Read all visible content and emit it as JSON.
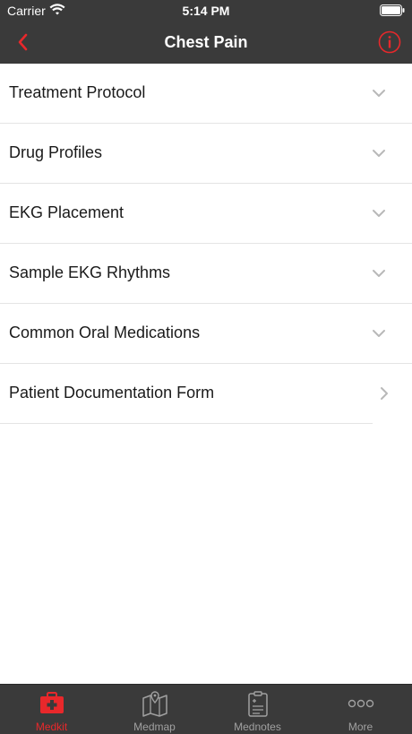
{
  "status_bar": {
    "carrier": "Carrier",
    "time": "5:14 PM"
  },
  "nav": {
    "title": "Chest Pain",
    "back_icon": "chevron-left-icon",
    "info_icon": "info-circle-icon"
  },
  "list": {
    "items": [
      {
        "label": "Treatment Protocol",
        "icon": "chevron-down-icon"
      },
      {
        "label": "Drug Profiles",
        "icon": "chevron-down-icon"
      },
      {
        "label": "EKG Placement",
        "icon": "chevron-down-icon"
      },
      {
        "label": "Sample EKG Rhythms",
        "icon": "chevron-down-icon"
      },
      {
        "label": "Common Oral Medications",
        "icon": "chevron-down-icon"
      },
      {
        "label": "Patient Documentation Form",
        "icon": "chevron-right-icon"
      }
    ]
  },
  "tabbar": {
    "tabs": [
      {
        "label": "Medkit",
        "icon": "medkit-icon",
        "active": true
      },
      {
        "label": "Medmap",
        "icon": "map-icon",
        "active": false
      },
      {
        "label": "Mednotes",
        "icon": "clipboard-icon",
        "active": false
      },
      {
        "label": "More",
        "icon": "more-dots-icon",
        "active": false
      }
    ]
  },
  "colors": {
    "accent": "#e8282b",
    "bar_bg": "#3a3a3a",
    "inactive_tab": "#a0a0a0"
  }
}
